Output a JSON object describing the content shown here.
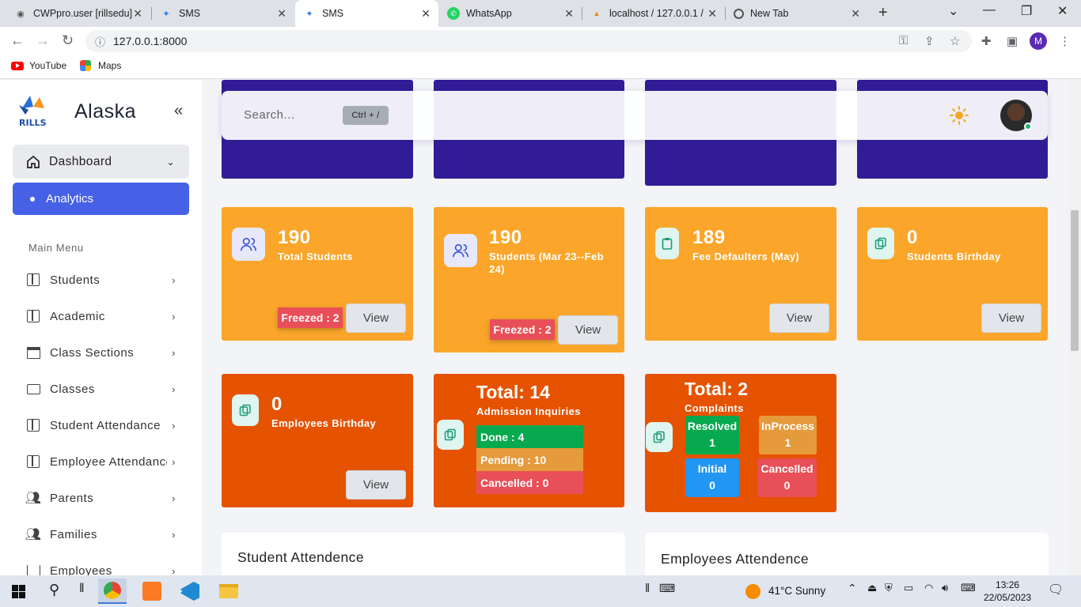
{
  "browser": {
    "tabs": [
      {
        "title": "CWPpro.user [rillsedu]"
      },
      {
        "title": "SMS"
      },
      {
        "title": "SMS"
      },
      {
        "title": "WhatsApp"
      },
      {
        "title": "localhost / 127.0.0.1 /"
      },
      {
        "title": "New Tab"
      }
    ],
    "url": "127.0.0.1:8000",
    "profile_initial": "M",
    "bookmarks": [
      {
        "label": "YouTube"
      },
      {
        "label": "Maps"
      }
    ]
  },
  "sidebar": {
    "brand": "Alaska",
    "logo_text": "RILLS",
    "dashboard_label": "Dashboard",
    "analytics_label": "Analytics",
    "menu_title": "Main Menu",
    "items": [
      {
        "label": "Students",
        "icon": "book-icon"
      },
      {
        "label": "Academic",
        "icon": "book-icon"
      },
      {
        "label": "Class Sections",
        "icon": "archive-icon"
      },
      {
        "label": "Classes",
        "icon": "presentation-icon"
      },
      {
        "label": "Student Attendance",
        "icon": "book-icon"
      },
      {
        "label": "Employee Attendance",
        "icon": "book-icon"
      },
      {
        "label": "Parents",
        "icon": "users-icon"
      },
      {
        "label": "Families",
        "icon": "users-icon"
      },
      {
        "label": "Employees",
        "icon": "building-icon"
      }
    ]
  },
  "topbar": {
    "search_placeholder": "Search...",
    "shortcut": "Ctrl + /"
  },
  "cards": {
    "total_students": {
      "value": "190",
      "label": "Total Students",
      "freezed": "Freezed : 2",
      "view": "View"
    },
    "students_range": {
      "value": "190",
      "label": "Students (Mar 23--Feb 24)",
      "freezed": "Freezed : 2",
      "view": "View"
    },
    "fee_defaulters": {
      "value": "189",
      "label": "Fee Defaulters (May)",
      "view": "View"
    },
    "students_birthday": {
      "value": "0",
      "label": "Students Birthday",
      "view": "View"
    },
    "employees_birthday": {
      "value": "0",
      "label": "Employees Birthday",
      "view": "View"
    },
    "admission": {
      "total": "Total: 14",
      "label": "Admission Inquiries",
      "done": "Done : 4",
      "pending": "Pending : 10",
      "cancelled": "Cancelled : 0"
    },
    "complaints": {
      "total": "Total: 2",
      "label": "Complaints",
      "resolved_label": "Resolved",
      "resolved_value": "1",
      "inprocess_label": "InProcess",
      "inprocess_value": "1",
      "initial_label": "Initial",
      "initial_value": "0",
      "cancelled_label": "Cancelled",
      "cancelled_value": "0"
    }
  },
  "panels": {
    "student_attendance": "Student Attendence",
    "employee_attendance": "Employees Attendence"
  },
  "taskbar": {
    "weather": "41°C  Sunny",
    "time": "13:26",
    "date": "22/05/2023"
  },
  "colors": {
    "accent": "#4661e6",
    "purple_card": "#321c96",
    "orange_card": "#fba62a",
    "red_card": "#e65300",
    "done": "#07a94f",
    "pending": "#e59a3c",
    "cancelled": "#e94f58",
    "initial": "#2196f3"
  }
}
